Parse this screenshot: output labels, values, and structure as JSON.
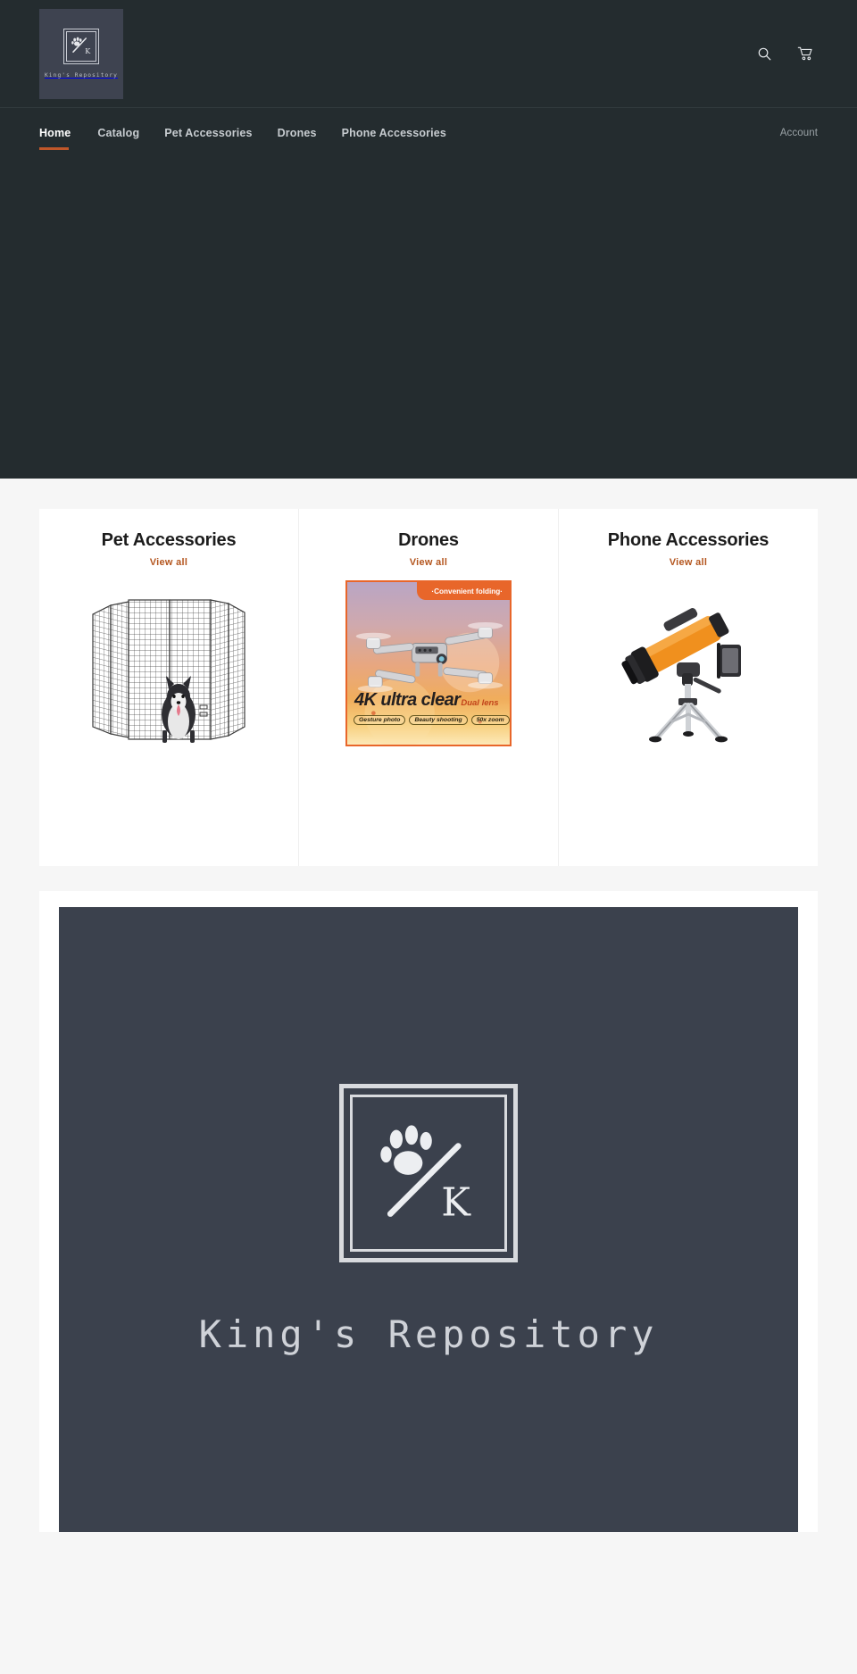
{
  "brand": {
    "name": "King's Repository",
    "logo_icon": "paw-slash-k-logo",
    "monogram_letter": "K"
  },
  "header": {
    "search_icon": "search-icon",
    "cart_icon": "shopping-cart-icon"
  },
  "nav": {
    "items": [
      {
        "label": "Home",
        "active": true
      },
      {
        "label": "Catalog",
        "active": false
      },
      {
        "label": "Pet Accessories",
        "active": false
      },
      {
        "label": "Drones",
        "active": false
      },
      {
        "label": "Phone Accessories",
        "active": false
      }
    ],
    "account_label": "Account"
  },
  "collections": {
    "view_all_label": "View all",
    "items": [
      {
        "title": "Pet Accessories",
        "view_all_label": "View all",
        "image_alt": "dog-playpen-with-husky-image"
      },
      {
        "title": "Drones",
        "view_all_label": "View all",
        "image_alt": "4k-drone-promo-image",
        "promo": {
          "banner": "·Convenient folding·",
          "headline": "4K ultra clear",
          "headline_sub": "Dual lens",
          "pills": [
            "Gesture photo",
            "Beauty shooting",
            "50x zoom"
          ]
        }
      },
      {
        "title": "Phone Accessories",
        "view_all_label": "View all",
        "image_alt": "telescope-with-phone-mount-image"
      }
    ]
  },
  "feature": {
    "wordmark": "King's Repository",
    "logo_icon": "paw-slash-k-logo",
    "monogram_letter": "K"
  },
  "colors": {
    "header_bg": "#242c2f",
    "page_bg": "#f6f6f6",
    "accent": "#b4561f",
    "nav_underline": "#c0572a",
    "logo_panel_bg": "#3b414d",
    "logo_block_bg": "#3e4350",
    "promo_orange": "#e8662a"
  }
}
